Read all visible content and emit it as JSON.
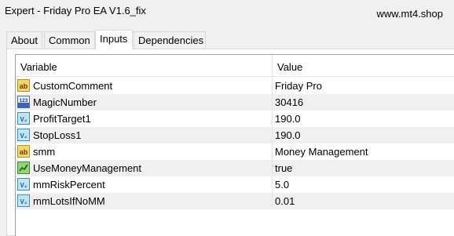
{
  "window": {
    "title": "Expert - Friday Pro EA V1.6_fix",
    "watermark": "www.mt4.shop"
  },
  "tabs": [
    {
      "label": "About",
      "active": false
    },
    {
      "label": "Common",
      "active": false
    },
    {
      "label": "Inputs",
      "active": true
    },
    {
      "label": "Dependencies",
      "active": false
    }
  ],
  "table": {
    "columns": {
      "variable": "Variable",
      "value": "Value"
    },
    "rows": [
      {
        "name": "CustomComment",
        "value": "Friday Pro",
        "icon": "string-icon"
      },
      {
        "name": "MagicNumber",
        "value": "30416",
        "icon": "integer-icon"
      },
      {
        "name": "ProfitTarget1",
        "value": "190.0",
        "icon": "double-icon"
      },
      {
        "name": "StopLoss1",
        "value": "190.0",
        "icon": "double-icon"
      },
      {
        "name": "smm",
        "value": "Money Management",
        "icon": "string-icon"
      },
      {
        "name": "UseMoneyManagement",
        "value": "true",
        "icon": "bool-icon"
      },
      {
        "name": "mmRiskPercent",
        "value": "5.0",
        "icon": "double-icon"
      },
      {
        "name": "mmLotsIfNoMM",
        "value": "0.01",
        "icon": "double-icon"
      }
    ]
  }
}
